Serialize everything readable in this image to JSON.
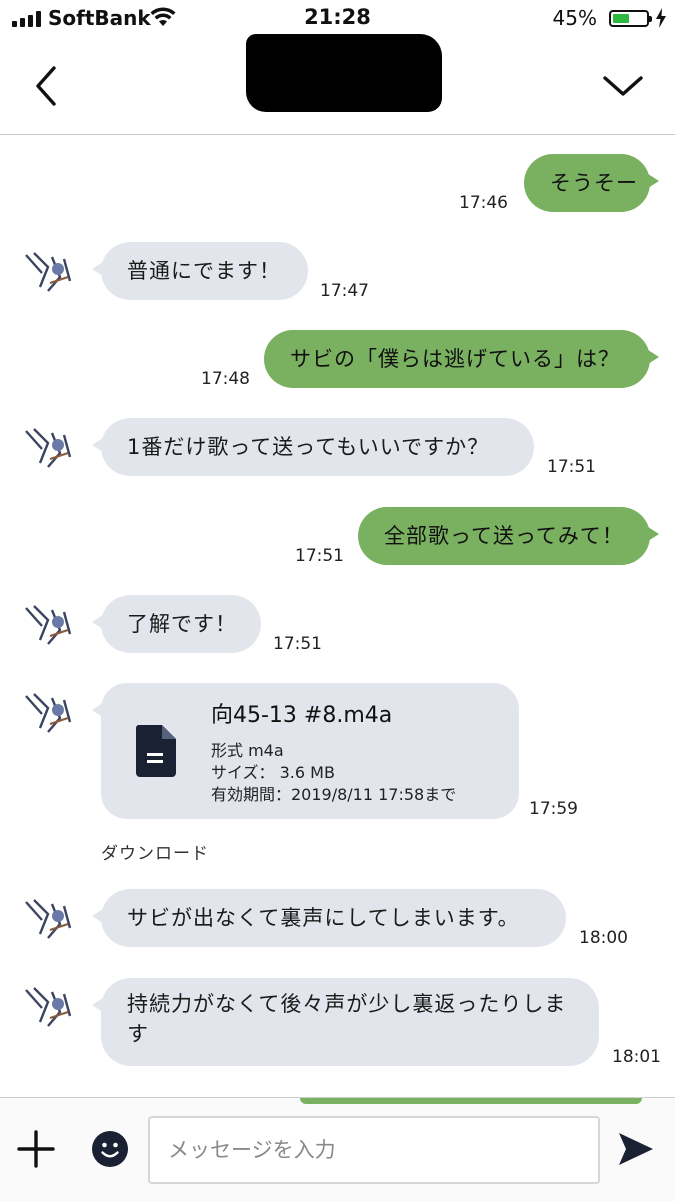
{
  "status_bar": {
    "carrier": "SoftBank",
    "time": "21:28",
    "battery_percent": "45%",
    "battery_level": 0.45
  },
  "header": {
    "back_icon": "chevron-left-icon",
    "menu_icon": "chevron-down-icon"
  },
  "messages": [
    {
      "side": "out",
      "text": "そうそー",
      "time": "17:46"
    },
    {
      "side": "in",
      "text": "普通にでます！",
      "time": "17:47"
    },
    {
      "side": "out",
      "text": "サビの「僕らは逃げている」は？",
      "time": "17:48"
    },
    {
      "side": "in",
      "text": "1番だけ歌って送ってもいいですか？",
      "time": "17:51"
    },
    {
      "side": "out",
      "text": "全部歌って送ってみて！",
      "time": "17:51"
    },
    {
      "side": "in",
      "text": "了解です！",
      "time": "17:51"
    },
    {
      "side": "in",
      "type": "file",
      "file_name": "向45-13 #8.m4a",
      "format": "形式 m4a",
      "size": "サイズ： 3.6 MB",
      "expiry": "有効期間：2019/8/11 17:58まで",
      "time": "17:59",
      "download_label": "ダウンロード"
    },
    {
      "side": "in",
      "text": "サビが出なくて裏声にしてしまいます。",
      "time": "18:00"
    },
    {
      "side": "in",
      "text": "持続力がなくて後々声が少し裏返ったりします",
      "time": "18:01"
    }
  ],
  "composer": {
    "placeholder": "メッセージを入力",
    "plus_icon": "plus-icon",
    "emoji_icon": "emoji-icon",
    "send_icon": "send-icon"
  },
  "colors": {
    "outgoing": "#7ab160",
    "incoming": "#e2e5ec"
  }
}
